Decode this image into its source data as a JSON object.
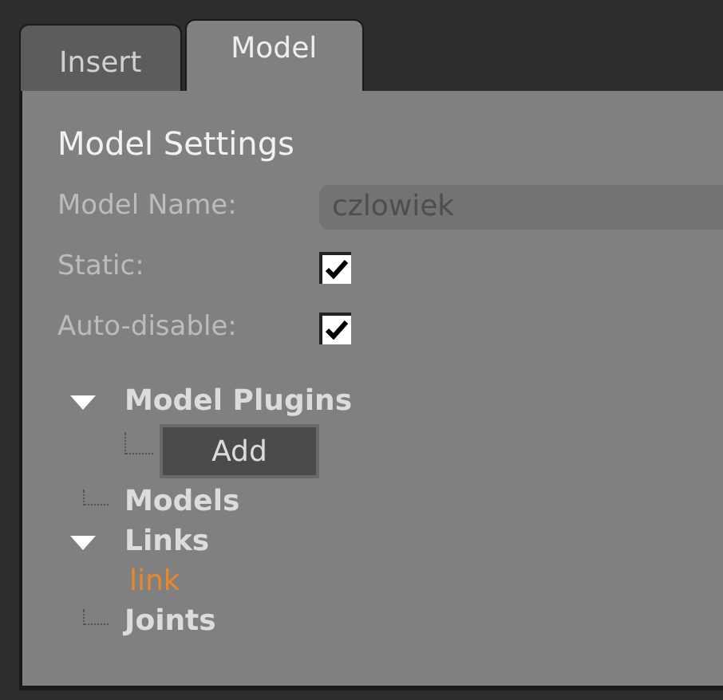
{
  "tabs": [
    {
      "label": "Insert",
      "selected": false
    },
    {
      "label": "Model",
      "selected": true
    }
  ],
  "title": "Model Settings",
  "fields": [
    {
      "kind": "text",
      "label": "Model Name:",
      "value": "czlowiek"
    },
    {
      "kind": "checkbox",
      "label": "Static:",
      "checked": true
    },
    {
      "kind": "checkbox",
      "label": "Auto-disable:",
      "checked": true
    }
  ],
  "tree": [
    {
      "label": "Model Plugins",
      "expanded": true,
      "children": [
        {
          "kind": "button",
          "label": "Add"
        }
      ]
    },
    {
      "label": "Models"
    },
    {
      "label": "Links",
      "expanded": true,
      "children": [
        {
          "kind": "item",
          "label": "link",
          "selected": true
        }
      ]
    },
    {
      "label": "Joints"
    }
  ]
}
